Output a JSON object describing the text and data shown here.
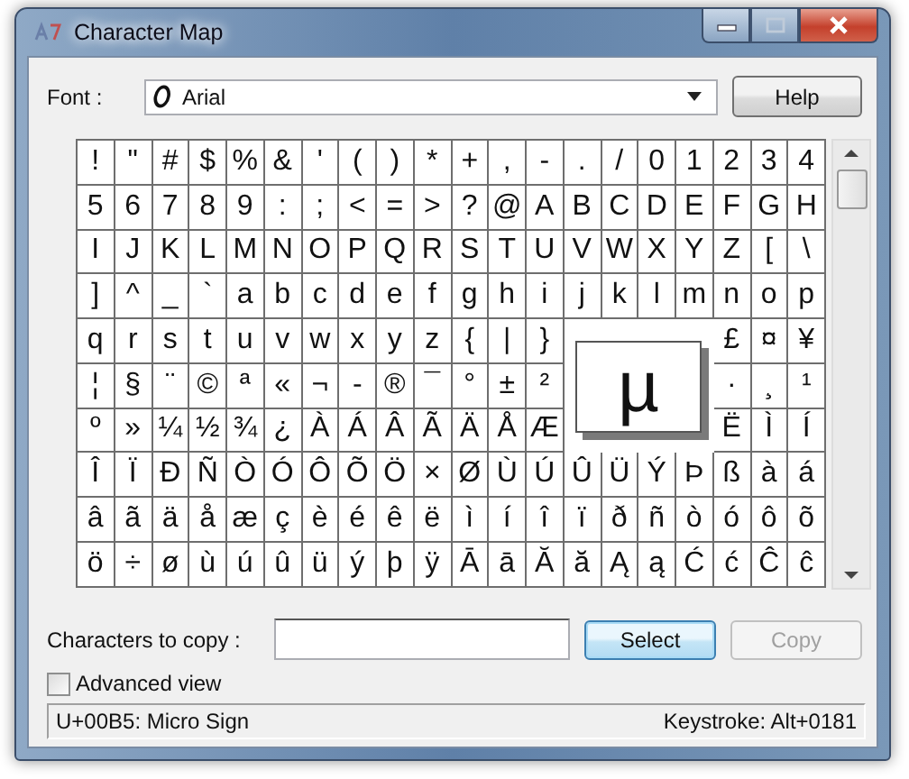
{
  "window": {
    "title": "Character Map"
  },
  "font": {
    "label": "Font :",
    "value": "Arial"
  },
  "help_button": {
    "label": "Help"
  },
  "grid": {
    "rows": [
      [
        "!",
        "\"",
        "#",
        "$",
        "%",
        "&",
        "'",
        "(",
        ")",
        "*",
        "+",
        ",",
        "-",
        ".",
        "/",
        "0",
        "1",
        "2",
        "3",
        "4"
      ],
      [
        "5",
        "6",
        "7",
        "8",
        "9",
        ":",
        ";",
        "<",
        "=",
        ">",
        "?",
        "@",
        "A",
        "B",
        "C",
        "D",
        "E",
        "F",
        "G",
        "H"
      ],
      [
        "I",
        "J",
        "K",
        "L",
        "M",
        "N",
        "O",
        "P",
        "Q",
        "R",
        "S",
        "T",
        "U",
        "V",
        "W",
        "X",
        "Y",
        "Z",
        "[",
        "\\"
      ],
      [
        "]",
        "^",
        "_",
        "`",
        "a",
        "b",
        "c",
        "d",
        "e",
        "f",
        "g",
        "h",
        "i",
        "j",
        "k",
        "l",
        "m",
        "n",
        "o",
        "p"
      ],
      [
        "q",
        "r",
        "s",
        "t",
        "u",
        "v",
        "w",
        "x",
        "y",
        "z",
        "{",
        "|",
        "}",
        null,
        null,
        null,
        null,
        "£",
        "¤",
        "¥"
      ],
      [
        "¦",
        "§",
        "¨",
        "©",
        "ª",
        "«",
        "¬",
        "-",
        "®",
        "¯",
        "°",
        "±",
        "²",
        null,
        null,
        null,
        null,
        "·",
        "¸",
        "¹"
      ],
      [
        "º",
        "»",
        "¼",
        "½",
        "¾",
        "¿",
        "À",
        "Á",
        "Â",
        "Ã",
        "Ä",
        "Å",
        "Æ",
        null,
        null,
        null,
        null,
        "Ë",
        "Ì",
        "Í"
      ],
      [
        "Î",
        "Ï",
        "Ð",
        "Ñ",
        "Ò",
        "Ó",
        "Ô",
        "Õ",
        "Ö",
        "×",
        "Ø",
        "Ù",
        "Ú",
        "Û",
        "Ü",
        "Ý",
        "Þ",
        "ß",
        "à",
        "á"
      ],
      [
        "â",
        "ã",
        "ä",
        "å",
        "æ",
        "ç",
        "è",
        "é",
        "ê",
        "ë",
        "ì",
        "í",
        "î",
        "ï",
        "ð",
        "ñ",
        "ò",
        "ó",
        "ô",
        "õ"
      ],
      [
        "ö",
        "÷",
        "ø",
        "ù",
        "ú",
        "û",
        "ü",
        "ý",
        "þ",
        "ÿ",
        "Ā",
        "ā",
        "Ă",
        "ă",
        "Ą",
        "ą",
        "Ć",
        "ć",
        "Ĉ",
        "ĉ"
      ]
    ]
  },
  "magnified": "µ",
  "copy_label": "Characters to copy :",
  "buttons": [
    {
      "label": "Select",
      "disabled": false,
      "focused": true
    },
    {
      "label": "Copy",
      "disabled": true,
      "focused": false
    }
  ],
  "advanced_view": {
    "label": "Advanced view",
    "checked": false
  },
  "status_bar": {
    "character": "U+00B5: Micro Sign",
    "keystroke": "Keystroke: Alt+0181"
  }
}
